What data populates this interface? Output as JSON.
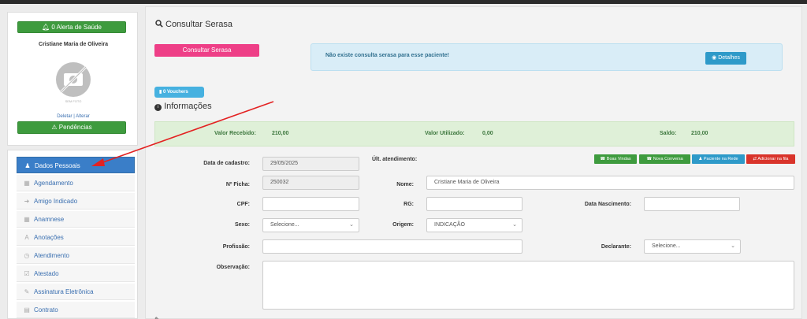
{
  "profile": {
    "alert_label": "0 Alerta de Saúde",
    "name": "Cristiane Maria de Oliveira",
    "avatar_caption": "SEM FOTO",
    "delete_label": "Deletar",
    "separator": "|",
    "change_label": "Alterar",
    "pending_label": "Pendências"
  },
  "sidebar": {
    "items": [
      {
        "label": "Dados Pessoais",
        "icon": "user-icon"
      },
      {
        "label": "Agendamento",
        "icon": "calendar-icon"
      },
      {
        "label": "Amigo Indicado",
        "icon": "share-icon"
      },
      {
        "label": "Anamnese",
        "icon": "grid-icon"
      },
      {
        "label": "Anotações",
        "icon": "font-icon"
      },
      {
        "label": "Atendimento",
        "icon": "clock-icon"
      },
      {
        "label": "Atestado",
        "icon": "check-icon"
      },
      {
        "label": "Assinatura Eletrônica",
        "icon": "pen-icon"
      },
      {
        "label": "Contrato",
        "icon": "document-icon"
      }
    ]
  },
  "serasa": {
    "title": "Consultar Serasa",
    "button_label": "Consultar Serasa",
    "message": "Não existe consulta serasa para esse paciente!",
    "details_label": "Detalhes"
  },
  "vouchers_label": "0 Vouchers",
  "info_title": "Informações",
  "summary": {
    "received_label": "Valor Recebido:",
    "received_value": "210,00",
    "used_label": "Valor Utilizado:",
    "used_value": "0,00",
    "balance_label": "Saldo:",
    "balance_value": "210,00"
  },
  "form": {
    "cadastro_label": "Data de cadastro:",
    "cadastro_value": "29/05/2025",
    "ult_label": "Últ. atendimento:",
    "ficha_label": "Nº Ficha:",
    "ficha_value": "250032",
    "nome_label": "Nome:",
    "nome_value": "Cristiane Maria de Oliveira",
    "cpf_label": "CPF:",
    "rg_label": "RG:",
    "nasc_label": "Data Nascimento:",
    "sexo_label": "Sexo:",
    "sexo_value": "Selecione...",
    "origem_label": "Origem:",
    "origem_value": "INDICAÇÃO",
    "prof_label": "Profissão:",
    "decl_label": "Declarante:",
    "decl_value": "Selecione...",
    "obs_label": "Observação:"
  },
  "actions": {
    "boas_vindas": "Boas Vindas",
    "nova_conversa": "Nova Conversa",
    "paciente_rede": "Paciente na Rede",
    "adicionar_fila": "Adicionar na fila"
  },
  "colors": {
    "green": "#3e9b3e",
    "pink": "#ee3f87",
    "blue": "#3a7ec8",
    "red": "#d9342b",
    "arrow": "#e32222"
  }
}
